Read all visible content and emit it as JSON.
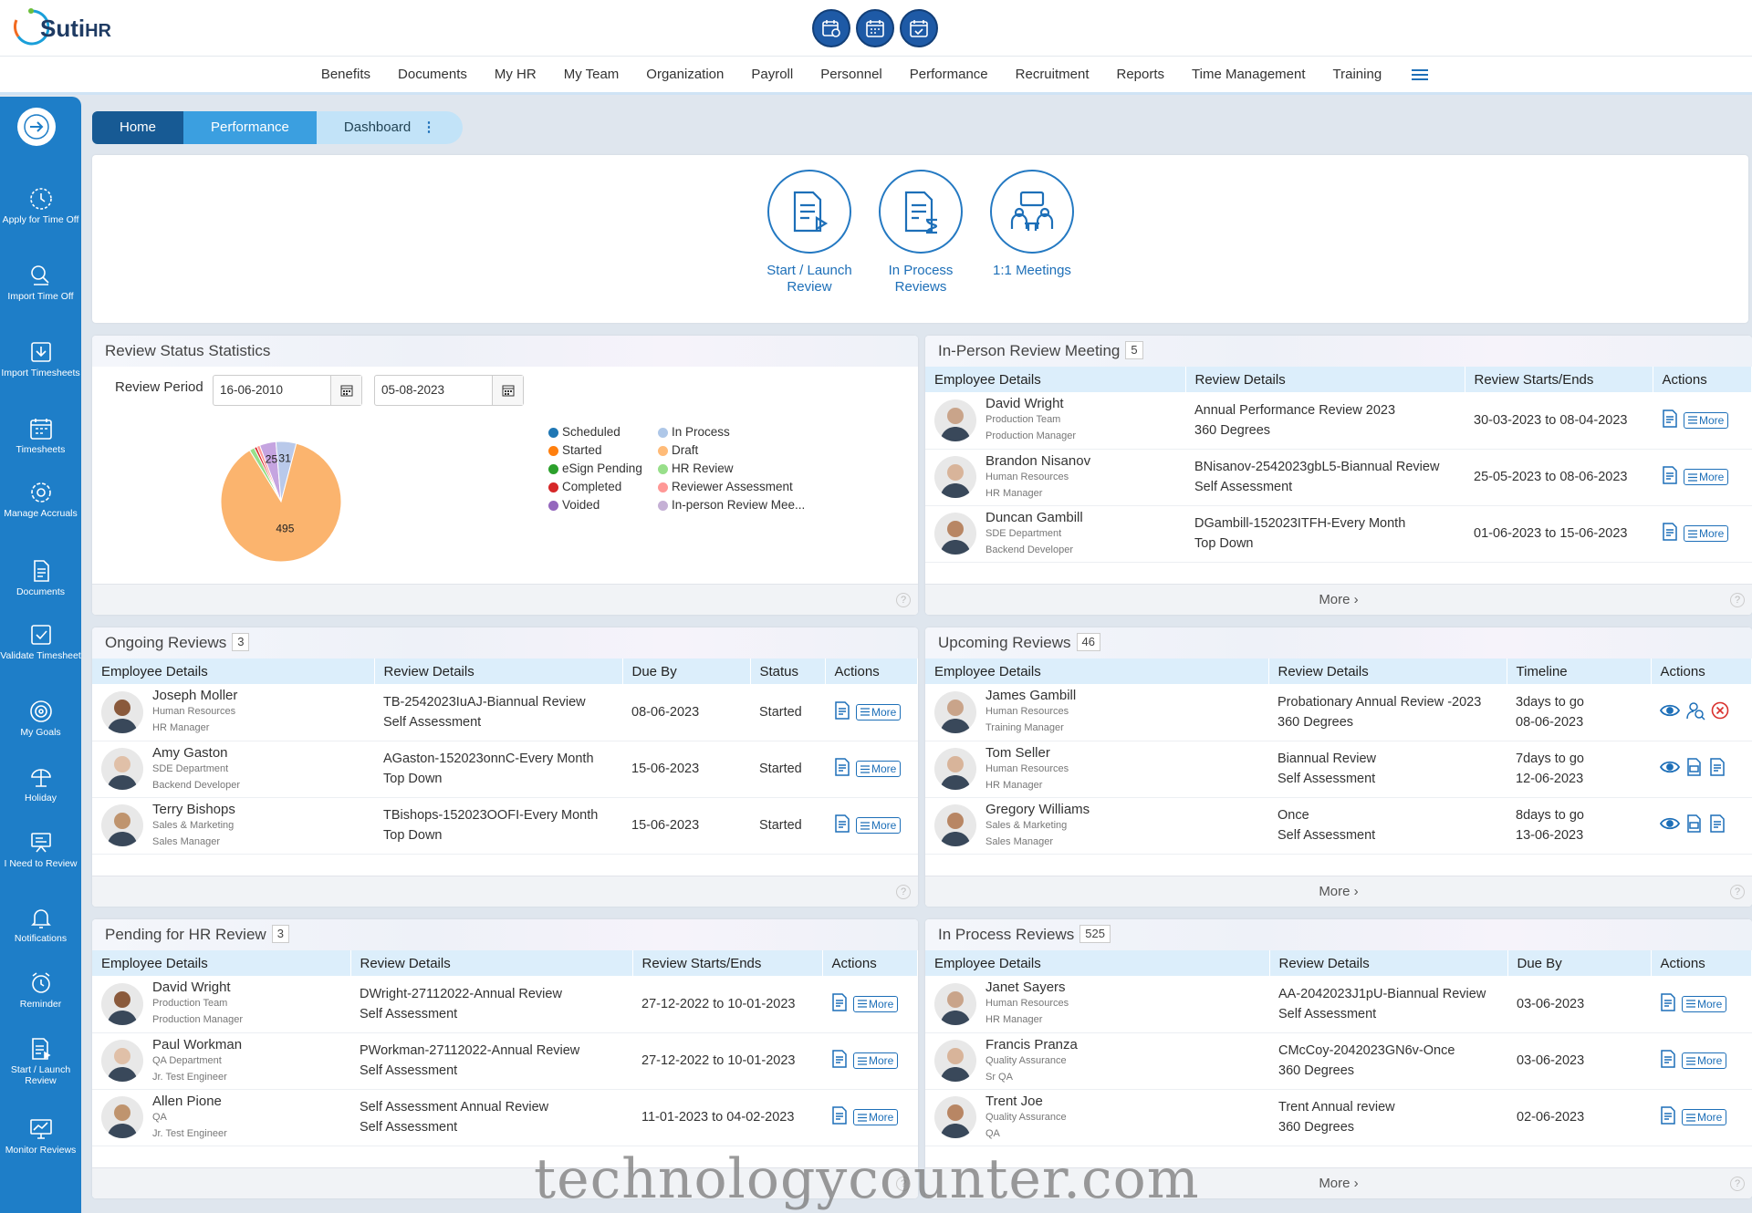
{
  "brand": {
    "logo_text": "Suti",
    "logo_suffix": "HR"
  },
  "nav": [
    "Benefits",
    "Documents",
    "My HR",
    "My Team",
    "Organization",
    "Payroll",
    "Personnel",
    "Performance",
    "Recruitment",
    "Reports",
    "Time Management",
    "Training"
  ],
  "sidebar": {
    "menu_label": "Menu",
    "items": [
      "Apply for Time Off",
      "Import Time Off",
      "Import Timesheets",
      "Timesheets",
      "Manage Accruals",
      "Documents",
      "Validate Timesheet",
      "My Goals",
      "Holiday",
      "I Need to Review",
      "Notifications",
      "Reminder",
      "Start / Launch Review",
      "Monitor Reviews"
    ]
  },
  "breadcrumb": {
    "home": "Home",
    "performance": "Performance",
    "dashboard": "Dashboard"
  },
  "hero": [
    {
      "label": "Start / Launch Review",
      "icon": "launch-review-icon"
    },
    {
      "label": "In Process Reviews",
      "icon": "in-process-icon"
    },
    {
      "label": "1:1 Meetings",
      "icon": "meetings-icon"
    }
  ],
  "stats": {
    "title": "Review Status Statistics",
    "period_label": "Review Period",
    "from": "16-06-2010",
    "to": "05-08-2023",
    "legend": [
      [
        "Scheduled",
        "#1f77b4"
      ],
      [
        "In Process",
        "#aec7e8"
      ],
      [
        "Started",
        "#ff7f0e"
      ],
      [
        "Draft",
        "#ffbb78"
      ],
      [
        "eSign Pending",
        "#2ca02c"
      ],
      [
        "HR Review",
        "#98df8a"
      ],
      [
        "Completed",
        "#d62728"
      ],
      [
        "Reviewer Assessment",
        "#ff9896"
      ],
      [
        "Voided",
        "#9467bd"
      ],
      [
        "In-person Review Mee...",
        "#c5b0d5"
      ]
    ]
  },
  "chart_data": {
    "type": "pie",
    "labels": [
      "Started",
      "HR Review",
      "Completed",
      "Voided",
      "In-person Review Meeting",
      "Draft"
    ],
    "slices": [
      {
        "label": "Draft",
        "value": 495,
        "color": "#fbb46e"
      },
      {
        "label": "Voided",
        "value": 25,
        "color": "#c5a4e0"
      },
      {
        "label": "In-person Review Meeting",
        "value": 31,
        "color": "#b9c9ea"
      }
    ],
    "data_labels": [
      "495",
      "25",
      "31"
    ],
    "more_slices": [
      {
        "label": "HR Review",
        "value": 8,
        "color": "#98df8a"
      },
      {
        "label": "Completed",
        "value": 4,
        "color": "#d62728"
      },
      {
        "label": "Reviewer Assessment",
        "value": 5,
        "color": "#ff9896"
      }
    ]
  },
  "inperson": {
    "title": "In-Person Review Meeting",
    "count": "5",
    "cols": [
      "Employee Details",
      "Review Details",
      "Review Starts/Ends",
      "Actions"
    ],
    "more": "More",
    "rows": [
      {
        "name": "David Wright",
        "dept": "Production Team",
        "role": "Production Manager",
        "r1": "Annual Performance Review 2023",
        "r2": "360 Degrees",
        "date": "30-03-2023 to 08-04-2023"
      },
      {
        "name": "Brandon Nisanov",
        "dept": "Human Resources",
        "role": "HR Manager",
        "r1": "BNisanov-2542023gbL5-Biannual Review",
        "r2": "Self Assessment",
        "date": "25-05-2023 to 08-06-2023"
      },
      {
        "name": "Duncan Gambill",
        "dept": "SDE Department",
        "role": "Backend Developer",
        "r1": "DGambill-152023ITFH-Every Month",
        "r2": "Top Down",
        "date": "01-06-2023 to 15-06-2023"
      }
    ]
  },
  "ongoing": {
    "title": "Ongoing Reviews",
    "count": "3",
    "cols": [
      "Employee Details",
      "Review Details",
      "Due By",
      "Status",
      "Actions"
    ],
    "rows": [
      {
        "name": "Joseph Moller",
        "dept": "Human Resources",
        "role": "HR Manager",
        "r1": "TB-2542023IuAJ-Biannual Review",
        "r2": "Self Assessment",
        "due": "08-06-2023",
        "status": "Started"
      },
      {
        "name": "Amy Gaston",
        "dept": "SDE Department",
        "role": "Backend Developer",
        "r1": "AGaston-152023onnC-Every Month",
        "r2": "Top Down",
        "due": "15-06-2023",
        "status": "Started"
      },
      {
        "name": "Terry Bishops",
        "dept": "Sales & Marketing",
        "role": "Sales Manager",
        "r1": "TBishops-152023OOFI-Every Month",
        "r2": "Top Down",
        "due": "15-06-2023",
        "status": "Started"
      }
    ]
  },
  "upcoming": {
    "title": "Upcoming Reviews",
    "count": "46",
    "cols": [
      "Employee Details",
      "Review Details",
      "Timeline",
      "Actions"
    ],
    "more": "More",
    "rows": [
      {
        "name": "James Gambill",
        "dept": "Human Resources",
        "role": "Training Manager",
        "r1": "Probationary Annual Review -2023",
        "r2": "360 Degrees",
        "t1": "3days to go",
        "t2": "08-06-2023"
      },
      {
        "name": "Tom Seller",
        "dept": "Human Resources",
        "role": "HR Manager",
        "r1": "Biannual Review",
        "r2": "Self Assessment",
        "t1": "7days to go",
        "t2": "12-06-2023"
      },
      {
        "name": "Gregory Williams",
        "dept": "Sales & Marketing",
        "role": "Sales Manager",
        "r1": "Once",
        "r2": "Self Assessment",
        "t1": "8days to go",
        "t2": "13-06-2023"
      }
    ]
  },
  "pending": {
    "title": "Pending for HR Review",
    "count": "3",
    "cols": [
      "Employee Details",
      "Review Details",
      "Review Starts/Ends",
      "Actions"
    ],
    "rows": [
      {
        "name": "David Wright",
        "dept": "Production Team",
        "role": "Production Manager",
        "r1": "DWright-27112022-Annual Review",
        "r2": "Self Assessment",
        "date": "27-12-2022 to 10-01-2023"
      },
      {
        "name": "Paul Workman",
        "dept": "QA Department",
        "role": "Jr. Test Engineer",
        "r1": "PWorkman-27112022-Annual Review",
        "r2": "Self Assessment",
        "date": "27-12-2022 to 10-01-2023"
      },
      {
        "name": "Allen Pione",
        "dept": "QA",
        "role": "Jr. Test Engineer",
        "r1": "Self Assessment Annual Review",
        "r2": "Self Assessment",
        "date": "11-01-2023 to 04-02-2023"
      }
    ]
  },
  "inprocess": {
    "title": "In Process Reviews",
    "count": "525",
    "cols": [
      "Employee Details",
      "Review Details",
      "Due By",
      "Actions"
    ],
    "more": "More",
    "rows": [
      {
        "name": "Janet Sayers",
        "dept": "Human Resources",
        "role": "HR Manager",
        "r1": "AA-2042023J1pU-Biannual Review",
        "r2": "Self Assessment",
        "due": "03-06-2023"
      },
      {
        "name": "Francis Pranza",
        "dept": "Quality Assurance",
        "role": "Sr QA",
        "r1": "CMcCoy-2042023GN6v-Once",
        "r2": "360 Degrees",
        "due": "03-06-2023"
      },
      {
        "name": "Trent Joe",
        "dept": "Quality Assurance",
        "role": "QA",
        "r1": "Trent Annual review",
        "r2": "360 Degrees",
        "due": "02-06-2023"
      }
    ]
  },
  "more_btn": "More",
  "watermark": "technologycounter.com"
}
